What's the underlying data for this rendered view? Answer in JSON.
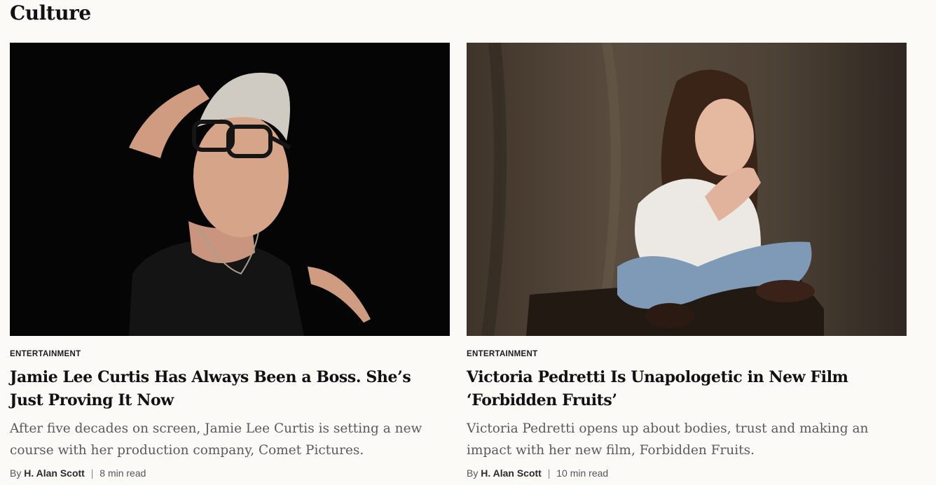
{
  "section": {
    "title": "Culture"
  },
  "articles": [
    {
      "image_alt": "Jamie Lee Curtis portrait",
      "kicker": "ENTERTAINMENT",
      "headline": "Jamie Lee Curtis Has Always Been a Boss. She’s Just Proving It Now",
      "dek": "After five decades on screen, Jamie Lee Curtis is setting a new course with her production company, Comet Pictures.",
      "by": "By",
      "author": "H. Alan Scott",
      "separator": "|",
      "read_time": "8 min read"
    },
    {
      "image_alt": "Victoria Pedretti portrait",
      "kicker": "ENTERTAINMENT",
      "headline": "Victoria Pedretti Is Unapologetic in New Film ‘Forbidden Fruits’",
      "dek": "Victoria Pedretti opens up about bodies, trust and making an impact with her new film, Forbidden Fruits.",
      "by": "By",
      "author": "H. Alan Scott",
      "separator": "|",
      "read_time": "10 min read"
    }
  ]
}
